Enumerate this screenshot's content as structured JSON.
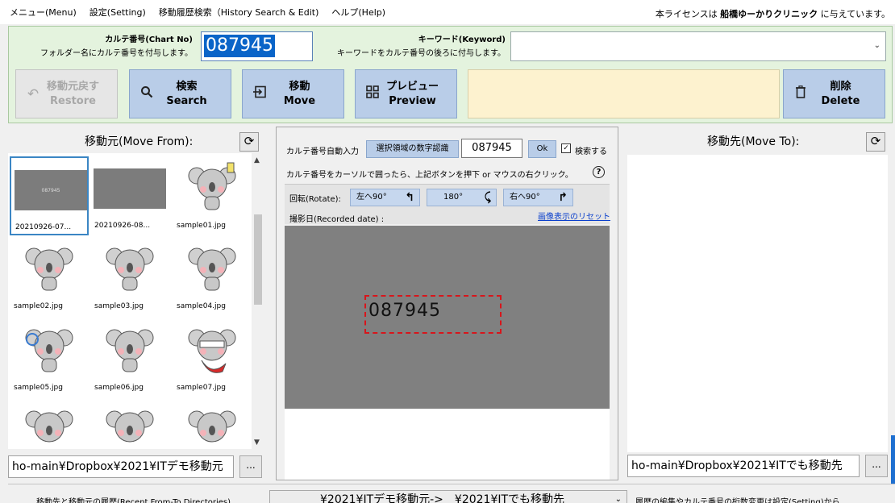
{
  "menu": {
    "items": [
      "メニュー(Menu)",
      "設定(Setting)",
      "移動履歴検索（History Search & Edit)",
      "ヘルプ(Help)"
    ],
    "license_prefix": "本ライセンスは ",
    "license_name": "船橋ゆーかりクリニック",
    "license_suffix": " に与えています。"
  },
  "top": {
    "chart_no_title": "カルテ番号(Chart No)",
    "chart_no_desc": "フォルダー名にカルテ番号を付与します。",
    "chart_no_value": "087945",
    "keyword_title": "キーワード(Keyword)",
    "keyword_desc": "キーワードをカルテ番号の後ろに付与します。",
    "keyword_value": ""
  },
  "buttons": {
    "restore": {
      "jp": "移動元戻す",
      "en": "Restore"
    },
    "search": {
      "jp": "検索",
      "en": "Search"
    },
    "move": {
      "jp": "移動",
      "en": "Move"
    },
    "preview": {
      "jp": "プレビュー",
      "en": "Preview"
    },
    "delete": {
      "jp": "削除",
      "en": "Delete"
    }
  },
  "left": {
    "title": "移動元(Move From):",
    "thumbnails": [
      "20210926-07...",
      "20210926-08...",
      "sample01.jpg",
      "sample02.jpg",
      "sample03.jpg",
      "sample04.jpg",
      "sample05.jpg",
      "sample06.jpg",
      "sample07.jpg"
    ],
    "path": "ho-main¥Dropbox¥2021¥ITデモ移動元",
    "browse": "..."
  },
  "center": {
    "auto_label": "カルテ番号自動入力",
    "recognize_button": "選択領域の数字認識",
    "recognized_value": "087945",
    "ok_button": "Ok",
    "search_check_label": "検索する",
    "instruction": "カルテ番号をカーソルで囲ったら、上記ボタンを押下 or マウスの右クリック。",
    "help": "?",
    "rotate_label": "回転(Rotate):",
    "rotate_left": "左へ90°",
    "rotate_180": "180°",
    "rotate_right": "右へ90°",
    "recorded_date_label": "撮影日(Recorded date) :",
    "reset_link": "画像表示のリセット",
    "ocr_text": "087945"
  },
  "right": {
    "title": "移動先(Move To):",
    "path": "ho-main¥Dropbox¥2021¥ITでも移動先",
    "browse": "..."
  },
  "bottom": {
    "history_label": "移動先と移動元の履歴(Recent From-To Directories)",
    "history_value": "¥2021¥ITデモ移動元->　¥2021¥ITでも移動先",
    "note": "履歴の編集やカルテ番号の桁数変更は設定(Setting)から"
  }
}
